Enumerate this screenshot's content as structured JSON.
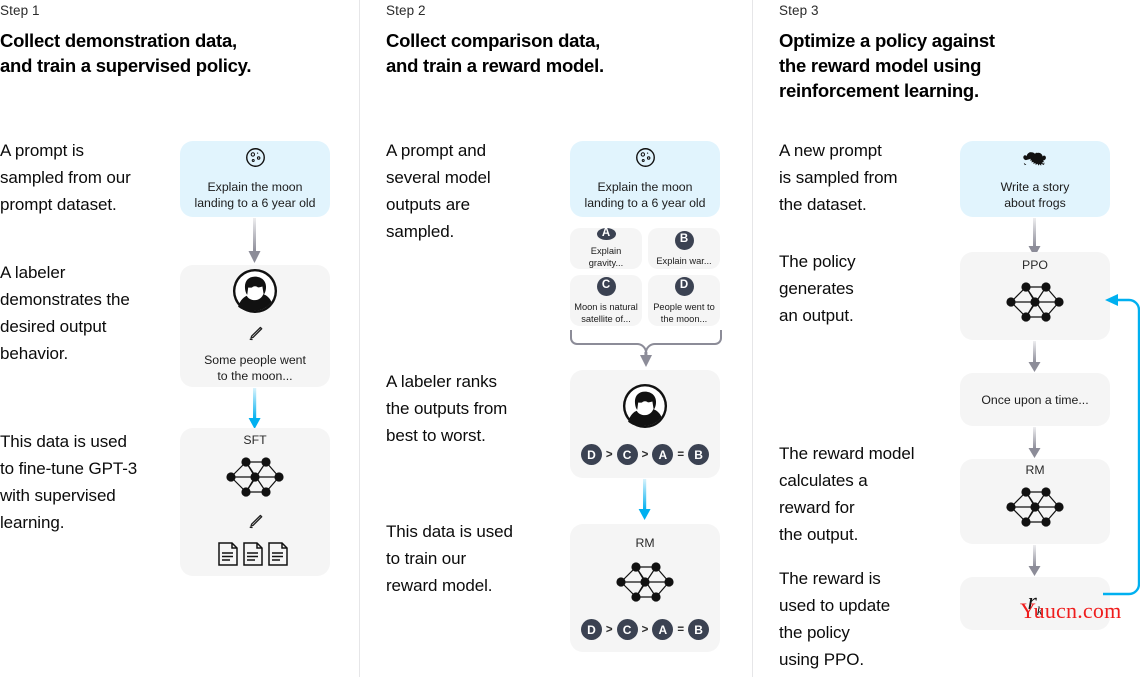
{
  "steps": [
    {
      "label": "Step 1",
      "title_line1": "Collect demonstration data,",
      "title_line2": "and train a supervised policy.",
      "narratives": [
        "A prompt is\nsampled from our\nprompt dataset.",
        "A labeler\ndemonstrates the\ndesired output\nbehavior.",
        "This data is used\nto fine-tune GPT-3\nwith supervised\nlearning."
      ],
      "prompt_box": {
        "icon": "moon-icon",
        "caption_line1": "Explain the moon",
        "caption_line2": "landing to a 6 year old"
      },
      "labeler_box": {
        "icon": "labeler-avatar-icon",
        "pencil": "pencil-icon",
        "caption_line1": "Some people went",
        "caption_line2": "to the moon..."
      },
      "model_box": {
        "title": "SFT",
        "network": "neural-network-icon",
        "pencil": "pencil-icon",
        "docs": "documents-icon"
      }
    },
    {
      "label": "Step 2",
      "title_line1": "Collect comparison data,",
      "title_line2": "and train a reward model.",
      "narratives": [
        "A prompt and\nseveral model\noutputs are\nsampled.",
        "A labeler ranks\nthe outputs from\nbest to worst.",
        "This data is used\nto train our\nreward model."
      ],
      "prompt_box": {
        "icon": "moon-icon",
        "caption_line1": "Explain the moon",
        "caption_line2": "landing to a 6 year old"
      },
      "options": [
        {
          "badge": "A",
          "text": "Explain gravity..."
        },
        {
          "badge": "B",
          "text": "Explain war..."
        },
        {
          "badge": "C",
          "text": "Moon is natural\nsatellite of..."
        },
        {
          "badge": "D",
          "text": "People went to\nthe moon..."
        }
      ],
      "rank_box": {
        "icon": "labeler-avatar-icon",
        "ranking": [
          "D",
          ">",
          "C",
          ">",
          "A",
          "=",
          "B"
        ]
      },
      "reward_box": {
        "title": "RM",
        "network": "neural-network-icon",
        "ranking": [
          "D",
          ">",
          "C",
          ">",
          "A",
          "=",
          "B"
        ]
      }
    },
    {
      "label": "Step 3",
      "title_line1": "Optimize a policy against",
      "title_line2": "the reward model using",
      "title_line3": "reinforcement learning.",
      "narratives": [
        "A new prompt\nis sampled from\nthe dataset.",
        "The policy\ngenerates\nan output.",
        "The reward model\ncalculates a\nreward for\nthe output.",
        "The reward is\nused to update\nthe policy\nusing PPO."
      ],
      "prompt_box": {
        "icon": "frog-icon",
        "caption_line1": "Write a story",
        "caption_line2": "about frogs"
      },
      "policy_box": {
        "title": "PPO",
        "network": "neural-network-icon"
      },
      "output_box": {
        "caption": "Once upon a time..."
      },
      "reward_box": {
        "title": "RM",
        "network": "neural-network-icon"
      },
      "reward_value_box": {
        "symbol": "r",
        "subscript": "k"
      }
    }
  ],
  "watermark": "Yuucn.com",
  "colors": {
    "prompt_box_bg": "#e1f4fd",
    "model_box_bg": "#f5f5f5",
    "badge_bg": "#3b4252",
    "arrow_gray": "#8c8c98",
    "arrow_blue": "#00b0f0",
    "watermark": "#ef1d1d",
    "divider": "#e6e6e8"
  }
}
